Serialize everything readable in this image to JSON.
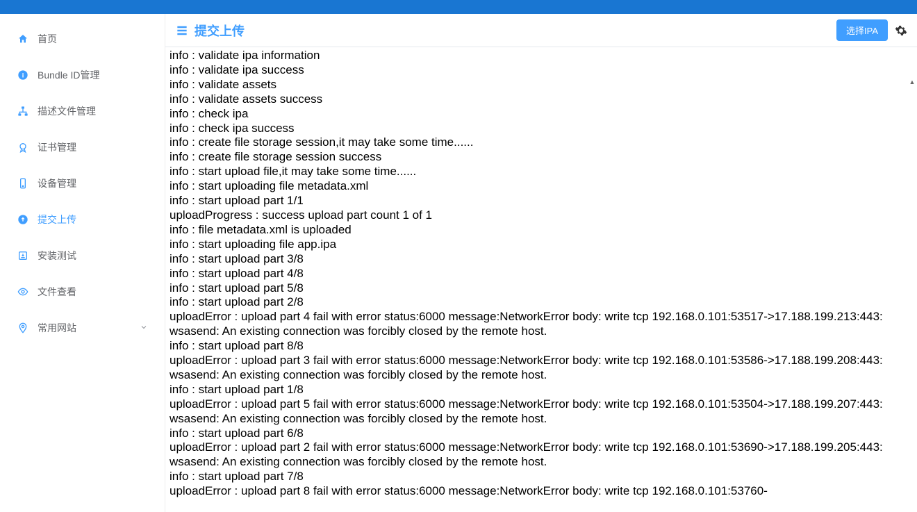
{
  "header": {
    "title": "提交上传",
    "select_ipa_label": "选择IPA"
  },
  "sidebar": {
    "items": [
      {
        "label": "首页",
        "icon": "home",
        "active": false
      },
      {
        "label": "Bundle ID管理",
        "icon": "info",
        "active": false
      },
      {
        "label": "描述文件管理",
        "icon": "sitemap",
        "active": false
      },
      {
        "label": "证书管理",
        "icon": "cert",
        "active": false
      },
      {
        "label": "设备管理",
        "icon": "device",
        "active": false
      },
      {
        "label": "提交上传",
        "icon": "upload",
        "active": true
      },
      {
        "label": "安装测试",
        "icon": "install",
        "active": false
      },
      {
        "label": "文件查看",
        "icon": "eye",
        "active": false
      },
      {
        "label": "常用网站",
        "icon": "pin",
        "active": false,
        "expandable": true
      }
    ]
  },
  "log_lines": [
    "info : validate ipa information",
    "info : validate ipa success",
    "info : validate assets",
    "info : validate assets success",
    "info : check ipa",
    "info : check ipa success",
    "info : create file storage session,it may take some time......",
    "info : create file storage session success",
    "info : start upload file,it may take some time......",
    "info : start uploading file metadata.xml",
    "info : start upload part 1/1",
    "uploadProgress : success upload part count 1 of 1",
    "info : file metadata.xml is uploaded",
    "info : start uploading file app.ipa",
    "info : start upload part 3/8",
    "info : start upload part 4/8",
    "info : start upload part 5/8",
    "info : start upload part 2/8",
    "uploadError : upload part 4 fail with error status:6000 message:NetworkError body: write tcp 192.168.0.101:53517->17.188.199.213:443: wsasend: An existing connection was forcibly closed by the remote host.",
    "info : start upload part 8/8",
    "uploadError : upload part 3 fail with error status:6000 message:NetworkError body: write tcp 192.168.0.101:53586->17.188.199.208:443: wsasend: An existing connection was forcibly closed by the remote host.",
    "info : start upload part 1/8",
    "uploadError : upload part 5 fail with error status:6000 message:NetworkError body: write tcp 192.168.0.101:53504->17.188.199.207:443: wsasend: An existing connection was forcibly closed by the remote host.",
    "info : start upload part 6/8",
    "uploadError : upload part 2 fail with error status:6000 message:NetworkError body: write tcp 192.168.0.101:53690->17.188.199.205:443: wsasend: An existing connection was forcibly closed by the remote host.",
    "info : start upload part 7/8",
    "uploadError : upload part 8 fail with error status:6000 message:NetworkError body: write tcp 192.168.0.101:53760-"
  ]
}
